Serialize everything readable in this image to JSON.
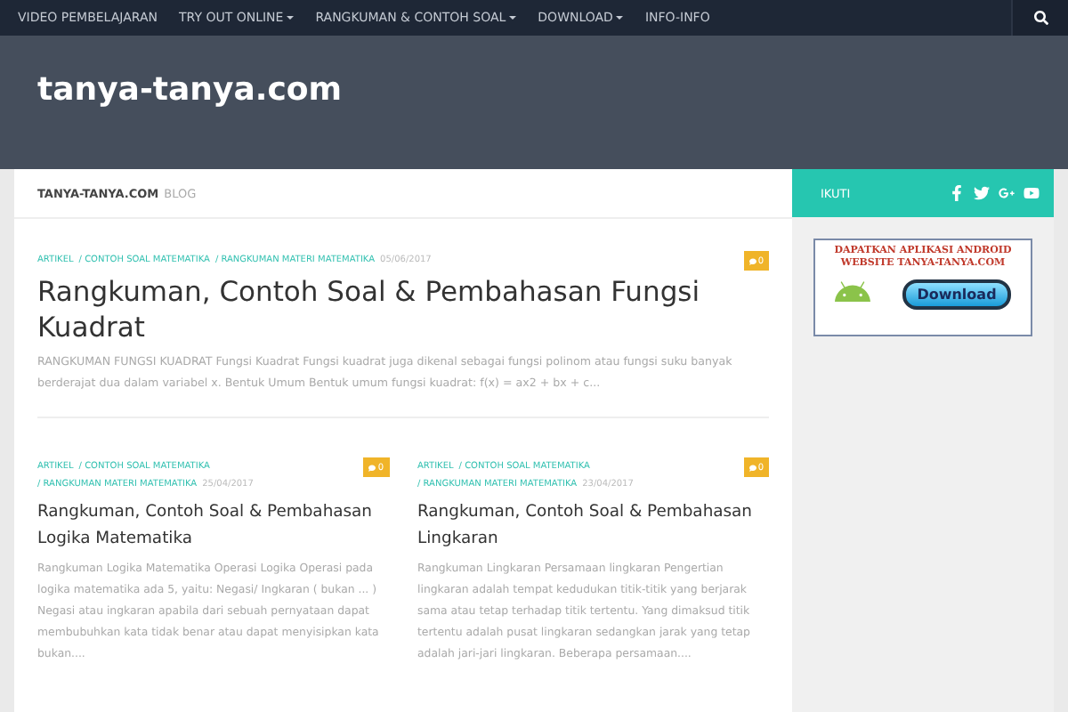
{
  "nav": {
    "items": [
      {
        "label": "VIDEO PEMBELAJARAN",
        "dropdown": false
      },
      {
        "label": "TRY OUT ONLINE",
        "dropdown": true
      },
      {
        "label": "RANGKUMAN & CONTOH SOAL",
        "dropdown": true
      },
      {
        "label": "DOWNLOAD",
        "dropdown": true
      },
      {
        "label": "INFO-INFO",
        "dropdown": false
      }
    ]
  },
  "site_title": "tanya-tanya.com",
  "breadcrumb": {
    "site": "TANYA-TANYA.COM",
    "section": "BLOG"
  },
  "featured": {
    "categories": [
      "ARTIKEL",
      "/ CONTOH SOAL MATEMATIKA",
      "/ RANGKUMAN MATERI MATEMATIKA"
    ],
    "date": "05/06/2017",
    "comments": "0",
    "title": "Rangkuman, Contoh Soal & Pembahasan Fungsi Kuadrat",
    "excerpt": "RANGKUMAN FUNGSI KUADRAT Fungsi Kuadrat Fungsi kuadrat juga dikenal sebagai fungsi polinom atau fungsi suku banyak berderajat dua dalam variabel x. Bentuk Umum Bentuk umum fungsi kuadrat: f(x) = ax2 + bx + c..."
  },
  "posts": [
    {
      "categories": [
        "ARTIKEL",
        "/ CONTOH SOAL MATEMATIKA",
        "/ RANGKUMAN MATERI MATEMATIKA"
      ],
      "date": "25/04/2017",
      "comments": "0",
      "title": "Rangkuman, Contoh Soal & Pembahasan Logika Matematika",
      "excerpt": "Rangkuman Logika Matematika Operasi Logika Operasi pada logika matematika ada 5, yaitu: Negasi/ Ingkaran ( bukan ... ) Negasi atau ingkaran apabila dari sebuah pernyataan dapat membubuhkan kata tidak benar atau dapat menyisipkan kata bukan...."
    },
    {
      "categories": [
        "ARTIKEL",
        "/ CONTOH SOAL MATEMATIKA",
        "/ RANGKUMAN MATERI MATEMATIKA"
      ],
      "date": "23/04/2017",
      "comments": "0",
      "title": "Rangkuman, Contoh Soal & Pembahasan Lingkaran",
      "excerpt": "Rangkuman Lingkaran Persamaan lingkaran Pengertian lingkaran adalah tempat kedudukan titik-titik yang berjarak sama atau tetap terhadap titik tertentu. Yang dimaksud titik tertentu adalah pusat lingkaran sedangkan jarak yang tetap adalah jari-jari lingkaran. Beberapa persamaan...."
    }
  ],
  "sidebar": {
    "title": "IKUTI",
    "social": [
      {
        "kind": "facebook"
      },
      {
        "kind": "twitter"
      },
      {
        "kind": "googleplus"
      },
      {
        "kind": "youtube"
      }
    ],
    "banner": {
      "heading": "DAPATKAN APLIKASI ANDROID WEBSITE TANYA-TANYA.COM",
      "button": "Download"
    }
  }
}
